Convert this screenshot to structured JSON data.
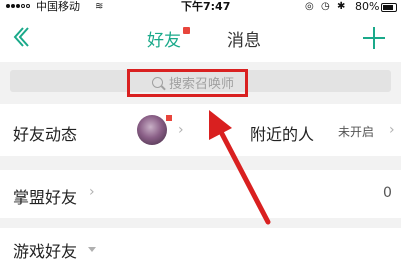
{
  "status_bar": {
    "carrier": "中国移动",
    "time": "下午7:47",
    "battery": "80%"
  },
  "nav": {
    "tabs": [
      {
        "label": "好友",
        "active": true,
        "badge": true
      },
      {
        "label": "消息",
        "active": false
      }
    ]
  },
  "search": {
    "placeholder": "搜索召唤师"
  },
  "rows": {
    "friend_feed": {
      "label": "好友动态",
      "badge": true
    },
    "nearby": {
      "label": "附近的人",
      "status": "未开启"
    },
    "league_friends": {
      "label": "掌盟好友",
      "count": "0"
    },
    "game_friends": {
      "label": "游戏好友"
    }
  },
  "colors": {
    "accent": "#1aa98a",
    "badge": "#e8453c",
    "annotation": "#d92020",
    "background_gray": "#f2f2f2"
  },
  "icons": [
    "back-icon",
    "add-icon",
    "search-icon",
    "chevron-right-icon",
    "chevron-down-icon",
    "wifi-icon",
    "bluetooth-icon",
    "battery-icon"
  ]
}
